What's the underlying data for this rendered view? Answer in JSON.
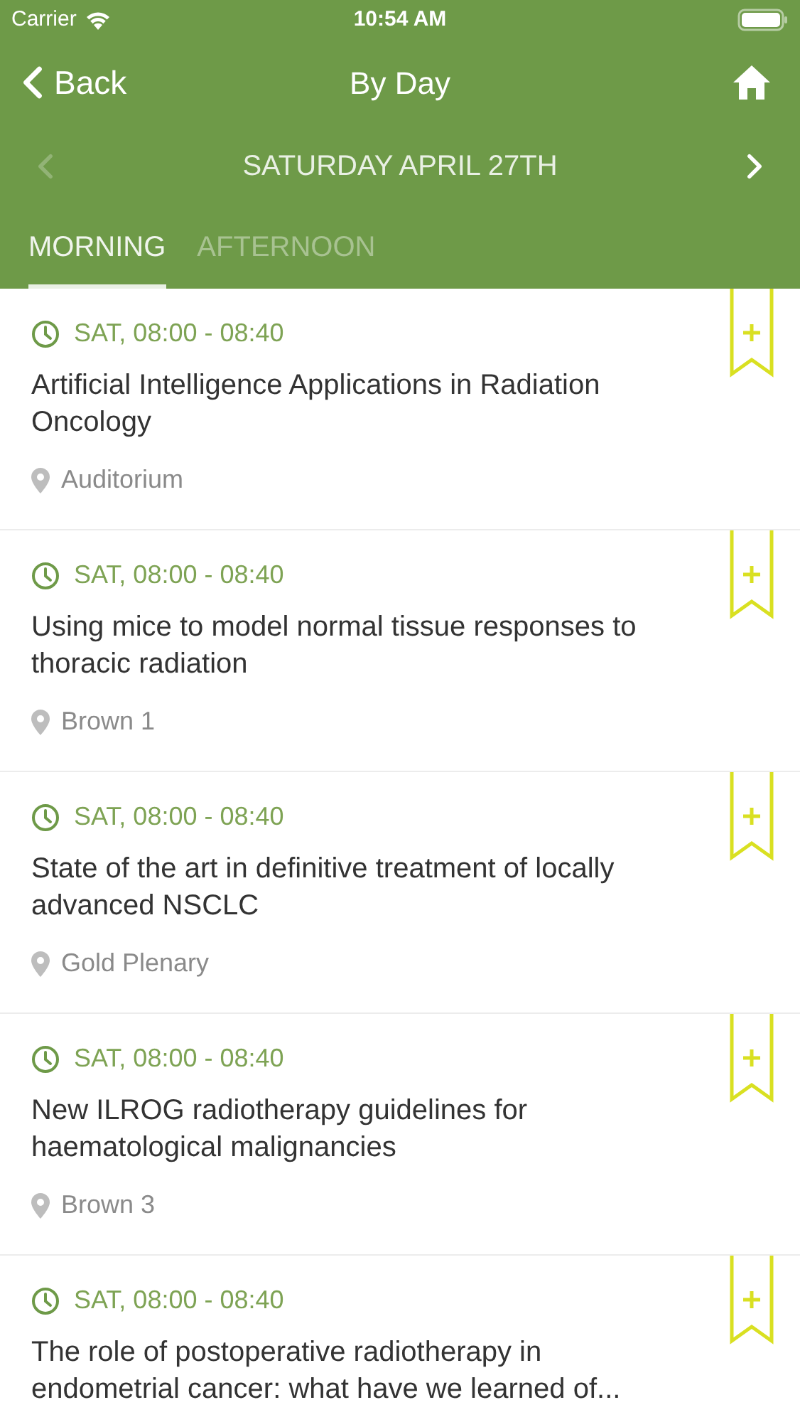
{
  "status_bar": {
    "carrier": "Carrier",
    "time": "10:54 AM"
  },
  "nav": {
    "back": "Back",
    "title": "By Day"
  },
  "date_bar": {
    "prev_disabled": true,
    "next_disabled": false,
    "date": "SATURDAY APRIL 27TH"
  },
  "tabs": [
    {
      "label": "MORNING",
      "selected": true
    },
    {
      "label": "AFTERNOON",
      "selected": false
    }
  ],
  "sessions": [
    {
      "time": "SAT, 08:00 - 08:40",
      "title": "Artificial Intelligence Applications in Radiation Oncology",
      "location": "Auditorium"
    },
    {
      "time": "SAT, 08:00 - 08:40",
      "title": "Using mice to model normal tissue responses to thoracic radiation",
      "location": "Brown 1"
    },
    {
      "time": "SAT, 08:00 - 08:40",
      "title": "State of the art in definitive treatment of locally advanced NSCLC",
      "location": "Gold Plenary"
    },
    {
      "time": "SAT, 08:00 - 08:40",
      "title": "New ILROG radiotherapy guidelines for haematological malignancies",
      "location": "Brown 3"
    },
    {
      "time": "SAT, 08:00 - 08:40",
      "title": "The role of postoperative radiotherapy in endometrial cancer: what have we learned of..."
    }
  ]
}
